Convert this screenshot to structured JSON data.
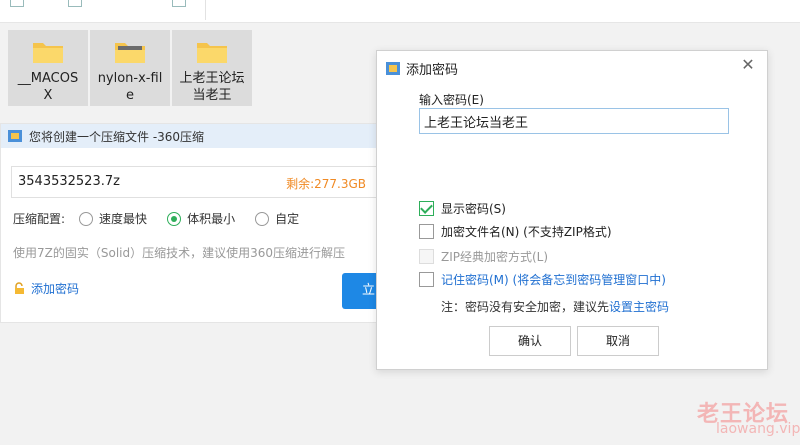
{
  "files": [
    {
      "name_line1": "__MACOS",
      "name_line2": "X",
      "icon": "folder-icon"
    },
    {
      "name_line1": "nylon-x-fil",
      "name_line2": "e",
      "icon": "folder-image-icon"
    },
    {
      "name_line1": "上老王论坛",
      "name_line2": "当老王",
      "icon": "folder-icon"
    }
  ],
  "compress_panel": {
    "title": "您将创建一个压缩文件 -360压缩",
    "filename": "3543532523.7z",
    "remaining": "剩余:277.3GB",
    "options_label": "压缩配置:",
    "options": [
      {
        "label": "速度最快",
        "selected": false
      },
      {
        "label": "体积最小",
        "selected": true
      },
      {
        "label": "自定",
        "selected": false
      }
    ],
    "hint": "使用7Z的固实（Solid）压缩技术，建议使用360压缩进行解压",
    "add_password": "添加密码",
    "start_button": "立即"
  },
  "dialog": {
    "title": "添加密码",
    "close_icon": "close-icon",
    "password_label": "输入密码(E)",
    "password_value": "上老王论坛当老王",
    "checkboxes": [
      {
        "label": "显示密码(S)",
        "checked": true,
        "disabled": false
      },
      {
        "label": "加密文件名(N) (不支持ZIP格式)",
        "checked": false,
        "disabled": false
      },
      {
        "label": "ZIP经典加密方式(L)",
        "checked": false,
        "disabled": true
      },
      {
        "label": "记住密码(M) (将会备忘到密码管理窗口中)",
        "checked": false,
        "disabled": false
      }
    ],
    "note_text": "注：密码没有安全加密，建议先",
    "note_link": "设置主密码",
    "ok_button": "确认",
    "cancel_button": "取消"
  },
  "watermark": {
    "line1": "老王论坛",
    "line2": "laowang.vip"
  },
  "colors": {
    "accent_blue": "#1e88e5",
    "link_blue": "#1f6fd1",
    "remain_orange": "#f08a24",
    "check_green": "#2eae5a"
  }
}
